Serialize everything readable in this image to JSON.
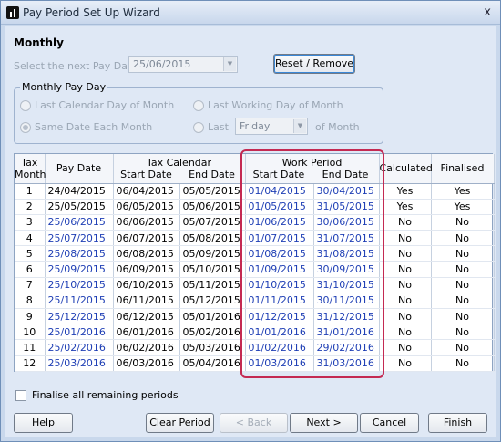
{
  "window": {
    "title": "Pay Period Set Up Wizard",
    "close_glyph": "x"
  },
  "heading": "Monthly",
  "next_pay": {
    "label": "Select the next Pay Date",
    "value": "25/06/2015"
  },
  "reset_button": "Reset / Remove",
  "group": {
    "title": "Monthly Pay Day",
    "opt_last_calendar": "Last Calendar Day of Month",
    "opt_last_working": "Last Working Day of Month",
    "opt_same_date": "Same Date Each Month",
    "opt_last": "Last",
    "weekday_value": "Friday",
    "of_month": "of Month"
  },
  "table": {
    "headers": {
      "tax_month": "Tax Month",
      "pay_date": "Pay Date",
      "tax_calendar": "Tax Calendar",
      "work_period": "Work Period",
      "start_date": "Start Date",
      "end_date": "End Date",
      "calculated": "Calculated",
      "finalised": "Finalised"
    },
    "rows": [
      [
        "1",
        "24/04/2015",
        "06/04/2015",
        "05/05/2015",
        "01/04/2015",
        "30/04/2015",
        "Yes",
        "Yes"
      ],
      [
        "2",
        "25/05/2015",
        "06/05/2015",
        "05/06/2015",
        "01/05/2015",
        "31/05/2015",
        "Yes",
        "Yes"
      ],
      [
        "3",
        "25/06/2015",
        "06/06/2015",
        "05/07/2015",
        "01/06/2015",
        "30/06/2015",
        "No",
        "No"
      ],
      [
        "4",
        "25/07/2015",
        "06/07/2015",
        "05/08/2015",
        "01/07/2015",
        "31/07/2015",
        "No",
        "No"
      ],
      [
        "5",
        "25/08/2015",
        "06/08/2015",
        "05/09/2015",
        "01/08/2015",
        "31/08/2015",
        "No",
        "No"
      ],
      [
        "6",
        "25/09/2015",
        "06/09/2015",
        "05/10/2015",
        "01/09/2015",
        "30/09/2015",
        "No",
        "No"
      ],
      [
        "7",
        "25/10/2015",
        "06/10/2015",
        "05/11/2015",
        "01/10/2015",
        "31/10/2015",
        "No",
        "No"
      ],
      [
        "8",
        "25/11/2015",
        "06/11/2015",
        "05/12/2015",
        "01/11/2015",
        "30/11/2015",
        "No",
        "No"
      ],
      [
        "9",
        "25/12/2015",
        "06/12/2015",
        "05/01/2016",
        "01/12/2015",
        "31/12/2015",
        "No",
        "No"
      ],
      [
        "10",
        "25/01/2016",
        "06/01/2016",
        "05/02/2016",
        "01/01/2016",
        "31/01/2016",
        "No",
        "No"
      ],
      [
        "11",
        "25/02/2016",
        "06/02/2016",
        "05/03/2016",
        "01/02/2016",
        "29/02/2016",
        "No",
        "No"
      ],
      [
        "12",
        "25/03/2016",
        "06/03/2016",
        "05/04/2016",
        "01/03/2016",
        "31/03/2016",
        "No",
        "No"
      ]
    ]
  },
  "finalise_label": "Finalise all remaining periods",
  "buttons": {
    "help": "Help",
    "clear_period": "Clear Period",
    "back": "< Back",
    "next": "Next >",
    "cancel": "Cancel",
    "finish": "Finish"
  },
  "colors": {
    "highlight": "#c42a52",
    "link_blue": "#1f3fb5"
  }
}
